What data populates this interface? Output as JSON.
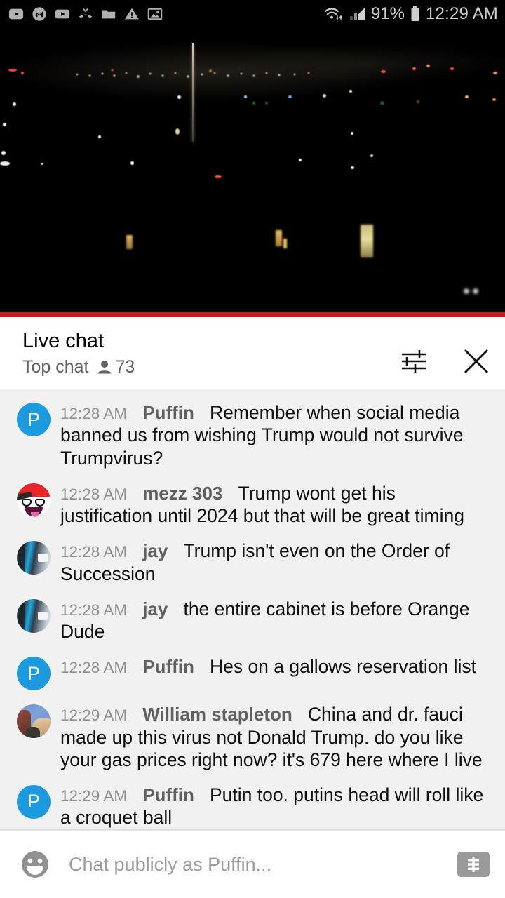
{
  "statusbar": {
    "icons": [
      "youtube-icon",
      "gmail-m-icon",
      "youtube-icon",
      "missed-call-icon",
      "folder-icon",
      "warning-icon",
      "image-icon"
    ],
    "wifi_icon": "wifi-icon",
    "signal_icon": "cell-signal-icon",
    "battery_percent": "91%",
    "battery_icon": "battery-icon",
    "clock": "12:29 AM"
  },
  "player": {
    "name": "live-stream-video",
    "description": "night cityscape with distant city lights",
    "progress_percent": 100,
    "progress_color": "#cc181e"
  },
  "chat_header": {
    "title": "Live chat",
    "mode": "Top chat",
    "viewer_icon": "person-icon",
    "viewer_count": "73",
    "settings_icon": "tune-icon",
    "close_icon": "close-icon"
  },
  "messages": [
    {
      "timestamp": "12:28 AM",
      "author": "Puffin",
      "text": "Remember when social media banned us from wishing Trump would not survive Trumpvirus?",
      "avatar_type": "initial",
      "avatar_initial": "P",
      "avatar_color": "#1c9ae0"
    },
    {
      "timestamp": "12:28 AM",
      "author": "mezz 303",
      "text": "Trump wont get his justification until 2024 but that will be great timing",
      "avatar_type": "awesome-face",
      "avatar_initial": "",
      "avatar_color": "#ffffff"
    },
    {
      "timestamp": "12:28 AM",
      "author": "jay",
      "text": "Trump isn't even on the Order of Succession",
      "avatar_type": "photo-jay",
      "avatar_initial": "",
      "avatar_color": "#35404c"
    },
    {
      "timestamp": "12:28 AM",
      "author": "jay",
      "text": "the entire cabinet is before Orange Dude",
      "avatar_type": "photo-jay",
      "avatar_initial": "",
      "avatar_color": "#35404c"
    },
    {
      "timestamp": "12:28 AM",
      "author": "Puffin",
      "text": "Hes on a gallows reservation list",
      "avatar_type": "initial",
      "avatar_initial": "P",
      "avatar_color": "#1c9ae0"
    },
    {
      "timestamp": "12:29 AM",
      "author": "William stapleton",
      "text": "China and dr. fauci made up this virus not Donald Trump. do you like your gas prices right now? it's 679 here where I live",
      "avatar_type": "photo-people",
      "avatar_initial": "",
      "avatar_color": "#6f95cf"
    },
    {
      "timestamp": "12:29 AM",
      "author": "Puffin",
      "text": "Putin too. putins head will roll like a croquet ball",
      "avatar_type": "initial",
      "avatar_initial": "P",
      "avatar_color": "#1c9ae0"
    }
  ],
  "input_bar": {
    "emoji_icon": "emoji-smiley-icon",
    "placeholder": "Chat publicly as Puffin...",
    "value": "",
    "superchat_icon": "superchat-dollar-icon"
  }
}
